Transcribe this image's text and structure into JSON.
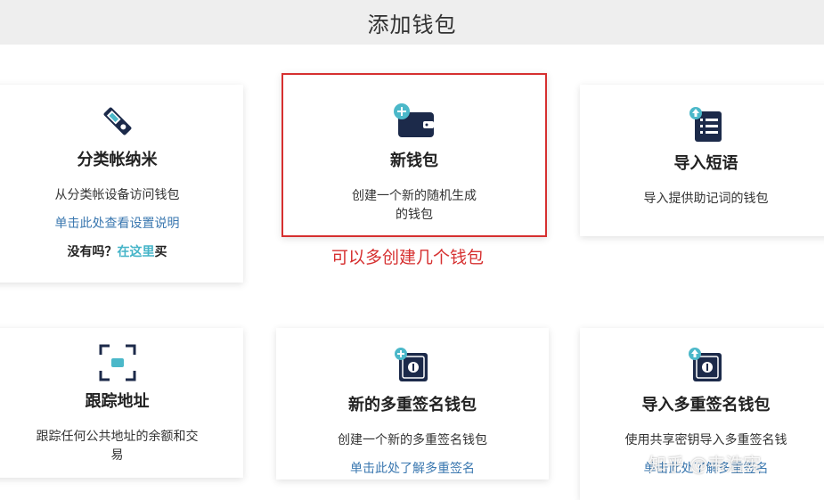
{
  "header": {
    "title": "添加钱包"
  },
  "cards": [
    {
      "icon": "ledger-usb-icon",
      "title": "分类帐纳米",
      "desc": "从分类帐设备访问钱包",
      "link": "单击此处查看设置说明",
      "buy_prefix": "没有吗？",
      "buy_link": "在这里",
      "buy_suffix": "买"
    },
    {
      "icon": "new-wallet-icon",
      "title": "新钱包",
      "desc_line1": "创建一个新的随机生成",
      "desc_line2": "的钱包"
    },
    {
      "icon": "import-phrase-icon",
      "title": "导入短语",
      "desc": "导入提供助记词的钱包"
    },
    {
      "icon": "track-address-icon",
      "title": "跟踪地址",
      "desc_line1": "跟踪任何公共地址的余额和交",
      "desc_line2": "易"
    },
    {
      "icon": "new-multisig-icon",
      "title": "新的多重签名钱包",
      "desc": "创建一个新的多重签名钱包",
      "link": "单击此处了解多重签名"
    },
    {
      "icon": "import-multisig-icon",
      "title": "导入多重签名钱包",
      "desc": "使用共享密钥导入多重签名钱",
      "link": "单击此处了解多重签名"
    }
  ],
  "annotation": "可以多创建几个钱包",
  "watermark": "知乎 @韦浩宪",
  "colors": {
    "navy": "#1c2a4a",
    "teal": "#4bb8c9",
    "link": "#3b78b0",
    "highlight_red": "#d63030"
  }
}
